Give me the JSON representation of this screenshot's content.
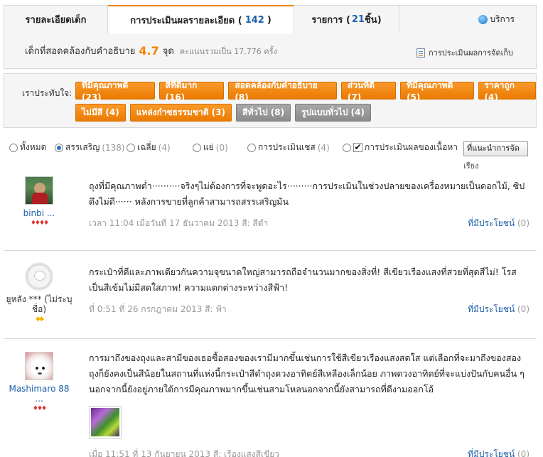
{
  "tabs": {
    "details": "รายละเอียดเด็ก",
    "review_label": "การประเมินผลรายละเอียด (",
    "review_count": "142",
    "review_close": ")",
    "items_label": "รายการ (",
    "items_count": "21",
    "items_suffix": "ชิ้น)",
    "service": "บริการ"
  },
  "summary": {
    "text": "เด็กที่สอดคล้องกับคำอธิบาย",
    "score": "4.7",
    "unit": "จุด",
    "points": "คะแนนรวมเป็น 17,776 ครั้ง",
    "link": "การประเมินผลการจัดเก็บ"
  },
  "tags": {
    "label": "เราประทับใจ:",
    "row1": [
      {
        "text": "ที่มีคุณภาพดี (23)",
        "style": "orange"
      },
      {
        "text": "สีที่ดีมาก (16)",
        "style": "orange"
      },
      {
        "text": "สอดคล้องกับคำอธิบาย (8)",
        "style": "orange"
      },
      {
        "text": "ส่วนที่ดี (7)",
        "style": "orange"
      },
      {
        "text": "ที่มีคุณภาพดี (5)",
        "style": "orange"
      },
      {
        "text": "ราคาถูก (4)",
        "style": "orange"
      }
    ],
    "row2": [
      {
        "text": "ไม่มีสี (4)",
        "style": "orange"
      },
      {
        "text": "แหล่งกำซธรรมชาติ (3)",
        "style": "orange"
      },
      {
        "text": "สีทั่วไป (8)",
        "style": "gray"
      },
      {
        "text": "รูปแบบทั่วไป (4)",
        "style": "gray"
      }
    ]
  },
  "filters": {
    "all": "ทั้งหมด",
    "praise": "สรรเสริญ",
    "praise_count": "(138)",
    "average": "เฉลี่ย",
    "average_count": "(4)",
    "bad": "แย่",
    "bad_count": "(0)",
    "eval": "การประเมินเชส",
    "eval_count": "(4)",
    "content_eval": "การประเมินผลของเนื้อหา",
    "sort_button": "ที่แนะนำการจัด",
    "sort_wrap": "เรียง"
  },
  "reviews": [
    {
      "user": "binbi ...",
      "text": "ถุงที่มีคุณภาพต่ำ··········จริงๆไม่ต้องการที่จะพูดอะไร·········การประเมินในช่วงปลายของเครื่องหมายเป็นดอกไม้, ซิปดึงไม่ดี······ หลังการขายที่ลูกค้าสามารถสรรเสริญมัน",
      "meta": "เวลา 11:04 เมื่อวันที่ 17 ธันวาคม 2013    สี: สีดำ",
      "useful_label": "ที่มีประโยชน์",
      "useful_count": "(0)"
    },
    {
      "user": "ยูหลัง *** (ไม่ระบุชื่อ)",
      "text": "กระเป๋าที่ดีและภาพเดียวกันความจุขนาดใหญ่สามารถถือจำนวนมากของสิ่งที่! สีเขียวเรืองแสงที่สวยที่สุดสีไม่! โรสเป็นสีเข้มไม่มีสดใสภาพ! ความแตกต่างระหว่างสีฟ้า!",
      "meta": "ที่ 0:51 ที่ 26 กรกฎาคม 2013    สี: ฟ้า",
      "useful_label": "ที่มีประโยชน์",
      "useful_count": "(0)"
    },
    {
      "user": "Mashimaro 88 ...",
      "text": "การมาถึงของถุงและสามีของเธอซื้อสองของเรามีมากขึ้นเช่นการใช้สีเขียวเรืองแสงสดใส แต่เลือกที่จะมาถึงของสองถุงก็ยังคงเป็นสีน้อยในสถานที่แห่งนี้กระเป๋าสีดำถุงดวงอาทิตย์สีเหลืองเล็กน้อย ภาพดวงอาทิตย์ที่จะแบ่งปันกับคนอื่น ๆ นอกจากนี้ยังอยู่ภายใต้การมีคุณภาพมากขึ้นเช่นสามโหลนอกจากนี้ยังสามารถที่ดีงามออกโอ้",
      "meta": "เมื่อ 11:51 ที่ 13 กันยายน 2013    สี: เรืองแสงสีเขียว",
      "useful_label": "ที่มีประโยชน์",
      "useful_count": "(0)"
    }
  ]
}
